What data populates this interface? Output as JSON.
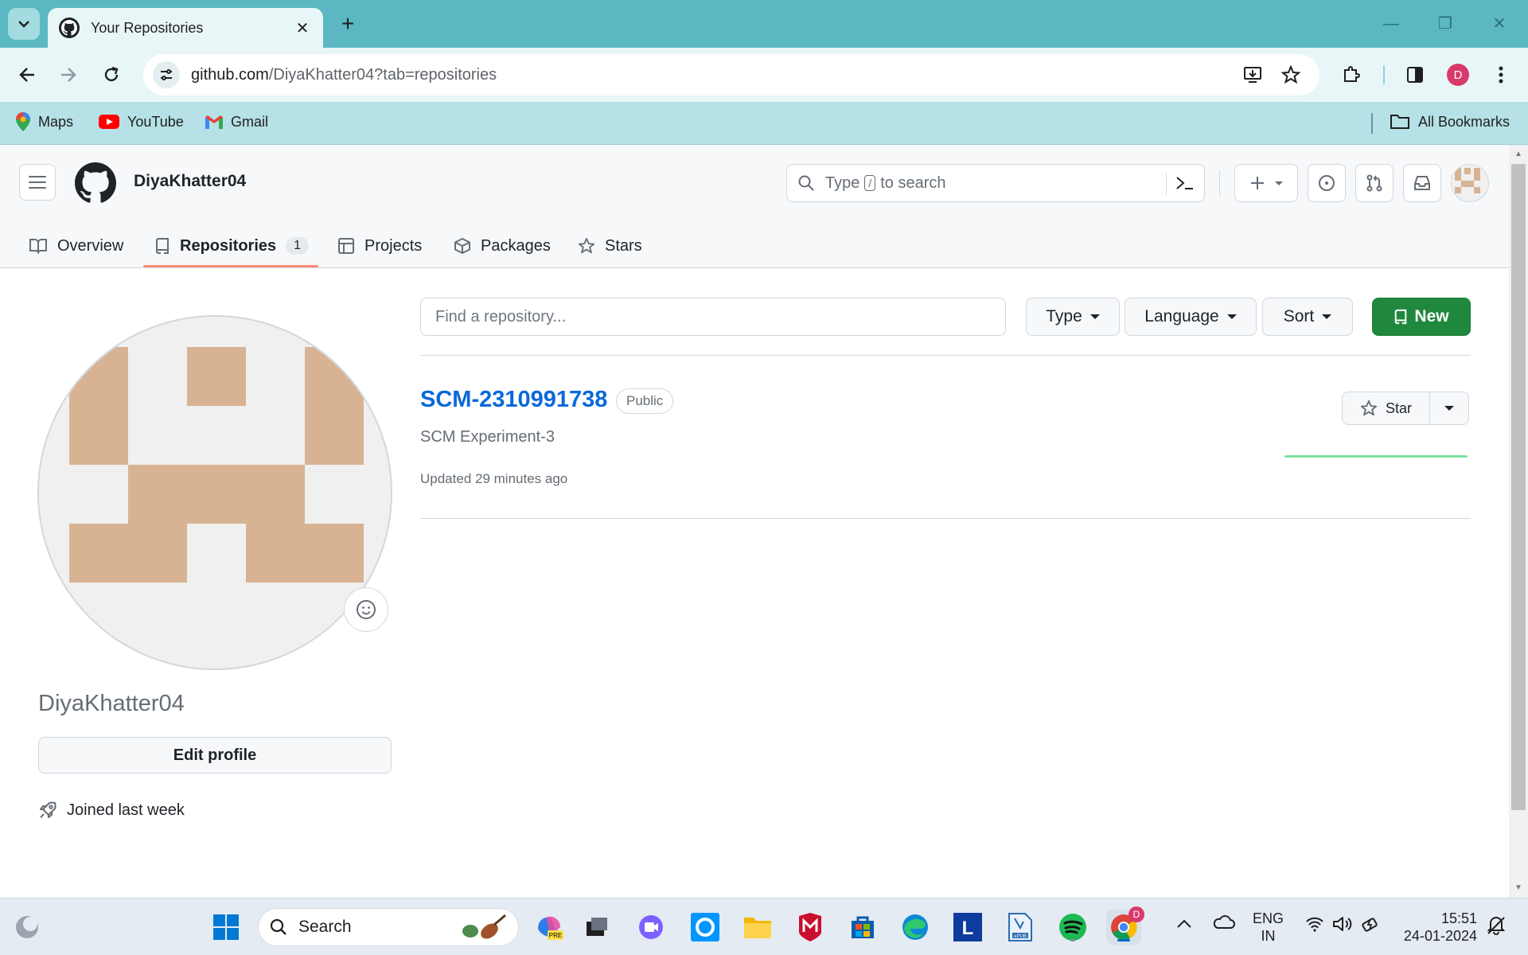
{
  "browser": {
    "tab_title": "Your Repositories",
    "url_host": "github.com",
    "url_rest": "/DiyaKhatter04?tab=repositories",
    "profile_letter": "D",
    "bookmarks": [
      {
        "label": "Maps",
        "icon": "maps-pin-icon"
      },
      {
        "label": "YouTube",
        "icon": "youtube-icon"
      },
      {
        "label": "Gmail",
        "icon": "gmail-icon"
      }
    ],
    "all_bookmarks": "All Bookmarks"
  },
  "github": {
    "username": "DiyaKhatter04",
    "search": {
      "before": "Type",
      "kbd": "/",
      "after": "to search"
    },
    "nav": [
      {
        "label": "Overview",
        "icon": "book-icon"
      },
      {
        "label": "Repositories",
        "icon": "repo-icon",
        "count": "1",
        "active": true
      },
      {
        "label": "Projects",
        "icon": "table-icon"
      },
      {
        "label": "Packages",
        "icon": "package-icon"
      },
      {
        "label": "Stars",
        "icon": "star-icon"
      }
    ],
    "profile": {
      "name": "DiyaKhatter04",
      "edit_label": "Edit profile",
      "joined": "Joined last week"
    },
    "filters": {
      "find_placeholder": "Find a repository...",
      "type": "Type",
      "language": "Language",
      "sort": "Sort",
      "new": "New"
    },
    "repos": [
      {
        "name": "SCM-2310991738",
        "visibility": "Public",
        "description": "SCM Experiment-3",
        "updated": "Updated 29 minutes ago",
        "star_label": "Star"
      }
    ]
  },
  "taskbar": {
    "search": "Search",
    "lang_top": "ENG",
    "lang_bottom": "IN",
    "time": "15:51",
    "date": "24-01-2024",
    "chrome_badge": "D"
  },
  "colors": {
    "accent_green": "#1f883d",
    "link_blue": "#0969da",
    "tab_underline": "#fd8c73",
    "browser_frame": "#5bb8c2",
    "identicon": "#d8b393"
  }
}
